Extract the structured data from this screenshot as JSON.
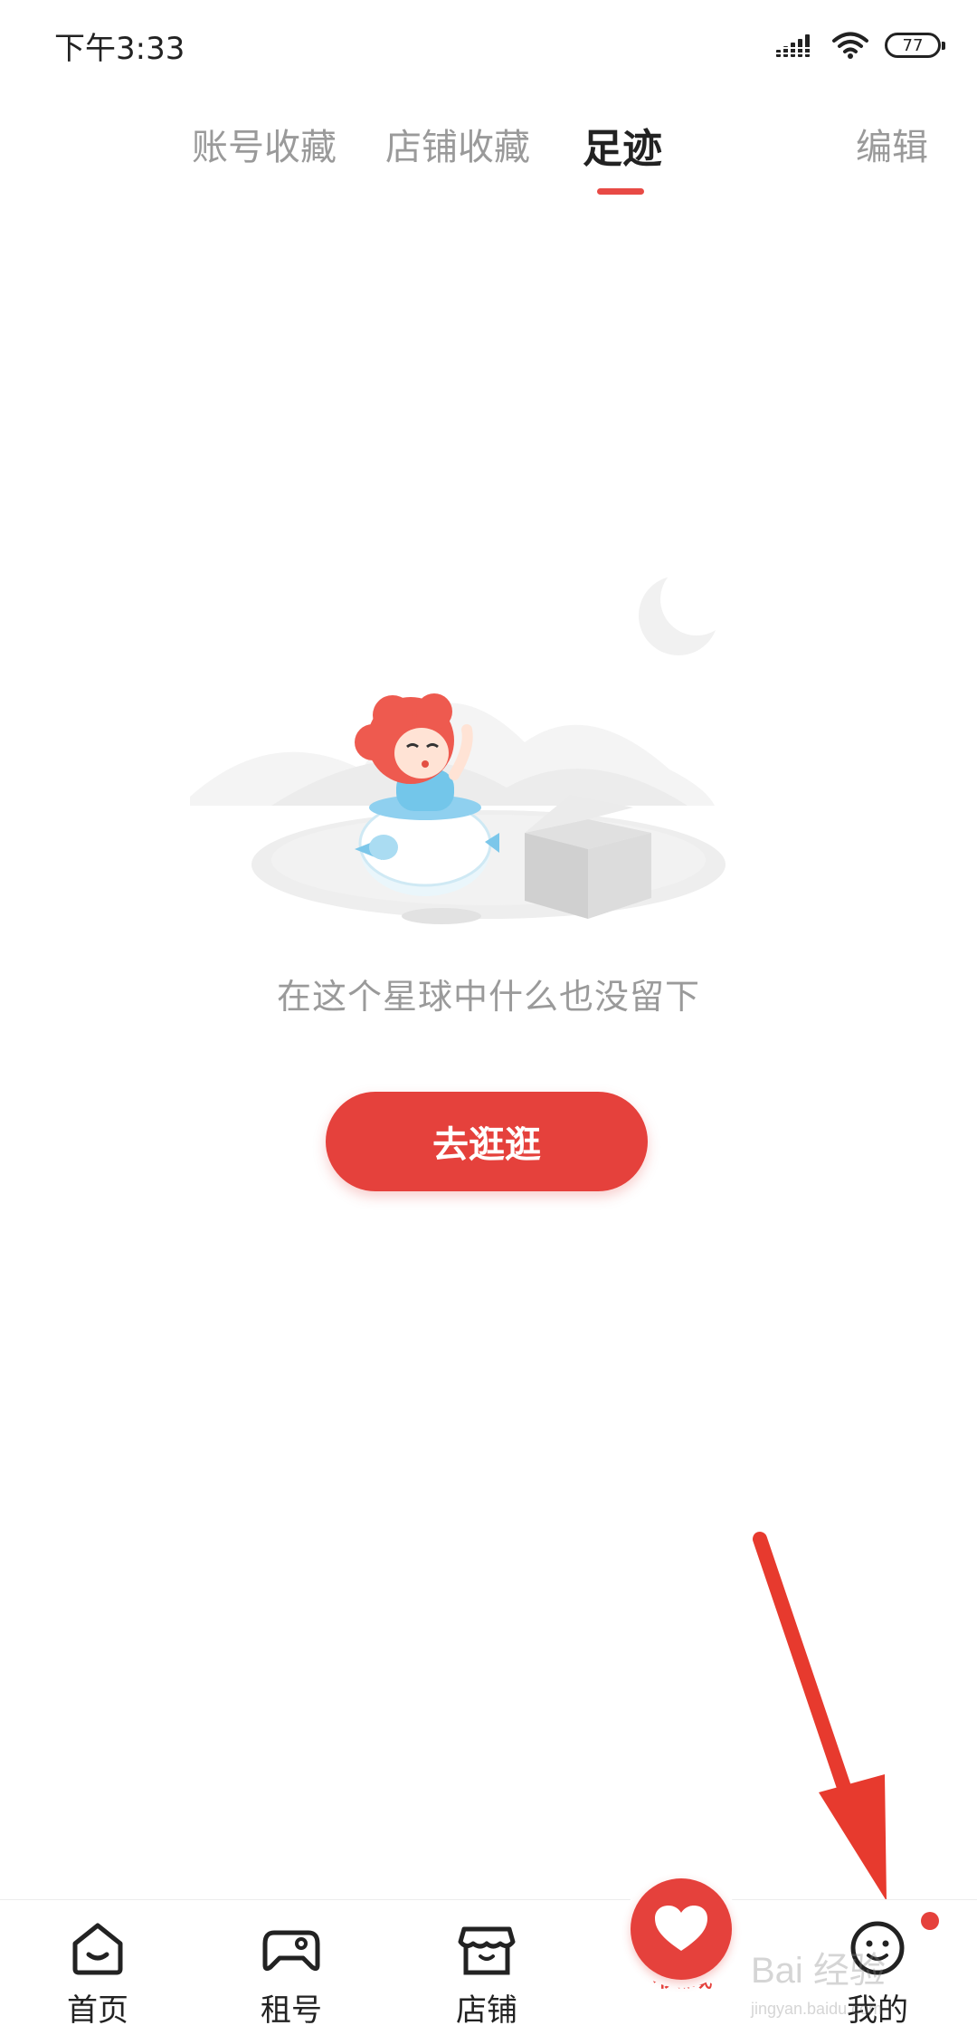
{
  "status_bar": {
    "time": "下午3:33",
    "battery": "77",
    "icons": [
      "signal-icon",
      "wifi-icon",
      "battery-icon"
    ]
  },
  "tabs": [
    {
      "label": "账号收藏",
      "active": false
    },
    {
      "label": "店铺收藏",
      "active": false
    },
    {
      "label": "足迹",
      "active": true
    }
  ],
  "edit_label": "编辑",
  "empty_state": {
    "message": "在这个星球中什么也没留下",
    "button_label": "去逛逛"
  },
  "bottom_nav": [
    {
      "label": "首页",
      "icon": "home-icon",
      "active": false
    },
    {
      "label": "租号",
      "icon": "gamepad-icon",
      "active": false
    },
    {
      "label": "店铺",
      "icon": "store-icon",
      "active": false
    },
    {
      "label": "收藏",
      "icon": "heart-icon",
      "active": true
    },
    {
      "label": "我的",
      "icon": "smiley-face-icon",
      "active": false
    }
  ],
  "colors": {
    "accent": "#e5413c",
    "text_primary": "#222222",
    "text_secondary": "#9a9a9a"
  },
  "watermark": {
    "line1": "Bai 经验",
    "line2": "jingyan.baidu.com"
  }
}
